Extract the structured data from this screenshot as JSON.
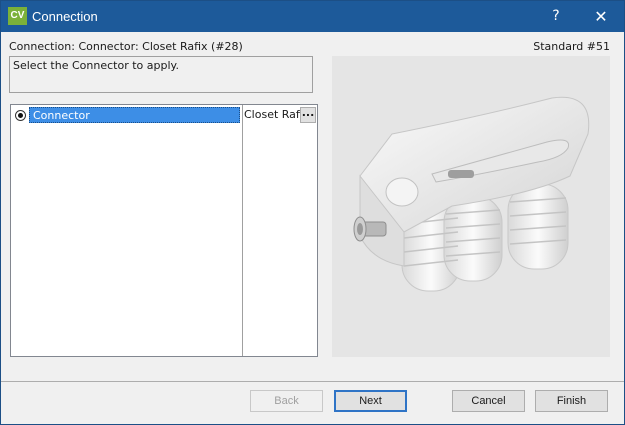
{
  "window": {
    "title": "Connection",
    "app_icon_text": "CV",
    "help_glyph": "?",
    "close_glyph": "✕"
  },
  "header": {
    "breadcrumb": "Connection: Connector: Closet Rafix (#28)",
    "standard": "Standard #51"
  },
  "prompt": {
    "text": "Select the Connector to apply."
  },
  "tree": {
    "rows": [
      {
        "label": "Connector",
        "value": "Closet Rafix",
        "button": "..."
      }
    ]
  },
  "footer": {
    "back": "Back",
    "next": "Next",
    "cancel": "Cancel",
    "finish": "Finish"
  },
  "colors": {
    "titlebar": "#1d5a9a",
    "selection": "#3d8ee6",
    "app_icon": "#7bb13a"
  },
  "icons": {
    "app": "cv-app-icon",
    "help": "help-icon",
    "close": "close-icon"
  }
}
